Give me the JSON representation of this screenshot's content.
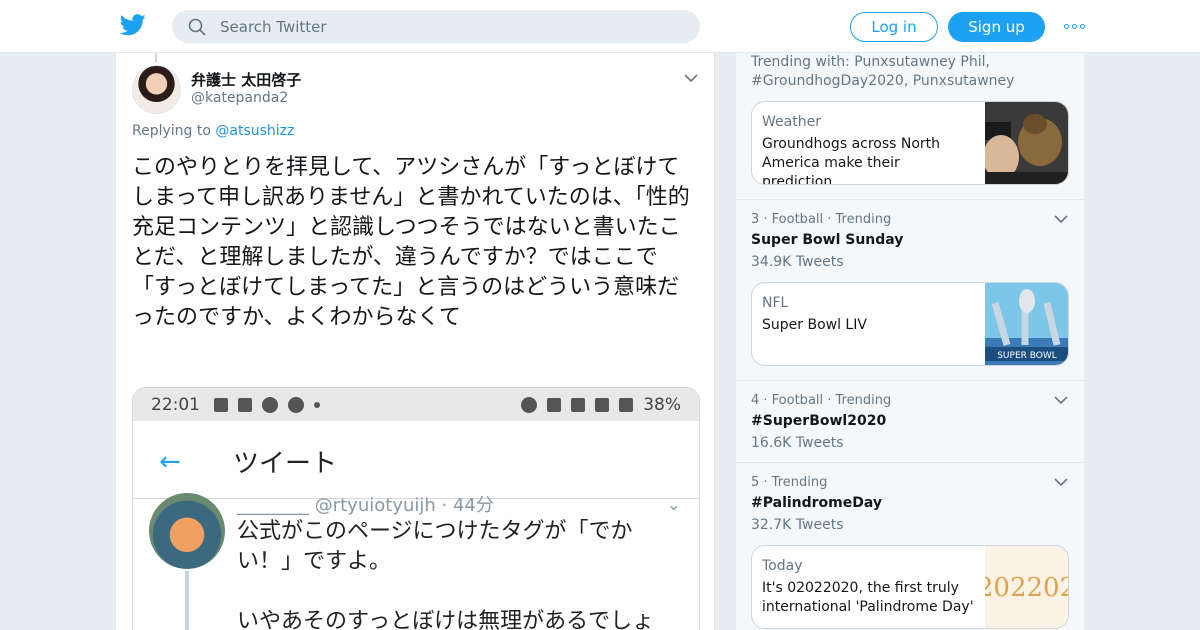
{
  "header": {
    "search_placeholder": "Search Twitter",
    "login_label": "Log in",
    "signup_label": "Sign up",
    "accent": "#1da1f2"
  },
  "tweet": {
    "display_name": "弁護士 太田啓子",
    "handle": "@katepanda2",
    "replying_prefix": "Replying to",
    "replying_to": "@atsushizz",
    "text": "このやりとりを拝見して、アツシさんが「すっとぼけてしまって申し訳ありません」と書かれていたのは、「性的充足コンテンツ」と認識しつつそうではないと書いたことだ、と理解しましたが、違うんですか？ではここで「すっとぼけてしまってた」と言うのはどういう意味だったのですか、よくわからなくて",
    "media": {
      "status_time": "22:01",
      "battery": "38%",
      "app_title": "ツイート",
      "inner_handle": "________ @rtyuiotyuijh · 44分",
      "inner_text": "公式がこのページにつけたタグが「でかい！」ですよ。\n\nいやあそのすっとぼけは無理があるでしょ"
    }
  },
  "sidebar": {
    "top_trend_context": "Trending with: Punxsutawney Phil, #GroundhogDay2020, Punxsutawney",
    "cards": [
      {
        "category": "Weather",
        "headline": "Groundhogs across North America make their prediction..."
      },
      {
        "category": "NFL",
        "headline": "Super Bowl LIV"
      },
      {
        "category": "Today",
        "headline": "It's 02022020, the first truly international 'Palindrome Day' ...",
        "thumb_text": "202202"
      }
    ],
    "trends": [
      {
        "meta": "3 · Football · Trending",
        "title": "Super Bowl Sunday",
        "count": "34.9K Tweets"
      },
      {
        "meta": "4 · Football · Trending",
        "title": "#SuperBowl2020",
        "count": "16.6K Tweets"
      },
      {
        "meta": "5 · Trending",
        "title": "#PalindromeDay",
        "count": "32.7K Tweets"
      }
    ]
  }
}
